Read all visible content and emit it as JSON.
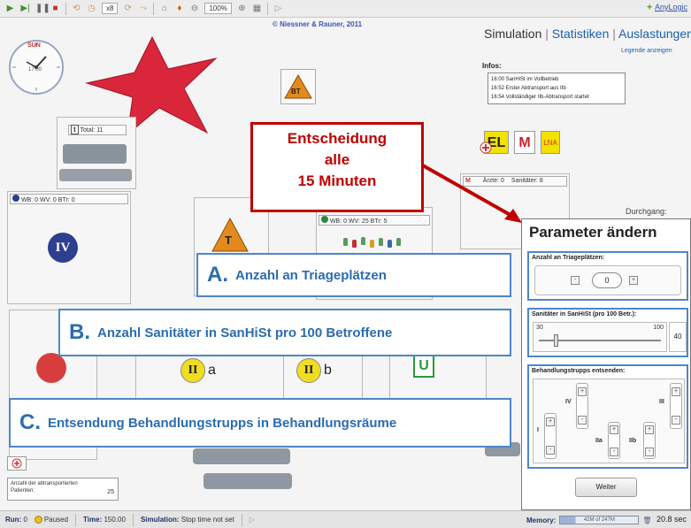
{
  "toolbar": {
    "speed": "x8",
    "zoom": "100%",
    "brand": "AnyLogic"
  },
  "header": {
    "copyright": "© Niessner & Rauner, 2011",
    "tabs": [
      "Simulation",
      "Statistiken",
      "Auslastungen"
    ],
    "separator": "|",
    "legend_link": "Legende anzeigen"
  },
  "infos": {
    "title": "Infos:",
    "lines": [
      "16:00 SanHiSt im Vollbetrieb",
      "16:52 Erster Abtransport aus IIb",
      "16:54 Vollständiger IIb-Abtransport startet"
    ]
  },
  "clock": {
    "label": "SUN",
    "time": "17:00"
  },
  "markers": {
    "bt": "BT",
    "t": "T",
    "el": "EL",
    "m": "M",
    "lna": "LNA",
    "u": "U",
    "iv": "IV",
    "iia": "II",
    "iia_suffix": "a",
    "iib": "II",
    "iib_suffix": "b",
    "room_m": "M"
  },
  "triage_box": {
    "icon": "t",
    "label": "Total:",
    "value": "11"
  },
  "bar_iv": {
    "wb_label": "WB:",
    "wb": "0",
    "wv_label": "WV:",
    "wv": "0",
    "btr_label": "BTr:",
    "btr": "0"
  },
  "bar_center": {
    "wb_label": "WB:",
    "wb": "0",
    "wv_label": "WV:",
    "wv": "25",
    "btr_label": "BTr:",
    "btr": "5"
  },
  "staff_bar": {
    "aerzte_label": "Ärzte:",
    "aerzte": "0",
    "sani_label": "Sanitäter:",
    "sani": "8"
  },
  "durchgang_label": "Durchgang:",
  "transported": {
    "label": "Anzahl der abtransportierten Patienten:",
    "value": "25"
  },
  "decision": {
    "line1": "Entscheidung",
    "line2": "alle",
    "line3": "15 Minuten"
  },
  "callouts": {
    "a": {
      "letter": "A.",
      "text": "Anzahl an Triageplätzen"
    },
    "b": {
      "letter": "B.",
      "text": "Anzahl Sanitäter in SanHiSt pro 100 Betroffene"
    },
    "c": {
      "letter": "C.",
      "text": "Entsendung Behandlungstrupps in Behandlungsräume"
    }
  },
  "params": {
    "title": "Parameter ändern",
    "triage": {
      "label": "Anzahl an Triageplätzen:",
      "value": "0",
      "minus": "-",
      "plus": "+"
    },
    "sani": {
      "label": "Sanitäter in SanHiSt (pro 100 Betr.):",
      "min": "30",
      "max": "100",
      "value": "40",
      "slider_fraction": 0.14
    },
    "trupps": {
      "label": "Behandlungstrupps entsenden:",
      "plus": "+",
      "minus": "-",
      "groups": [
        "I",
        "IV",
        "IIa",
        "IIb",
        "III"
      ]
    },
    "weiter": "Weiter"
  },
  "status": {
    "run_label": "Run:",
    "run": "0",
    "state": "Paused",
    "time_label": "Time:",
    "time": "150.00",
    "sim_label": "Simulation:",
    "sim": "Stop time not set",
    "memory_label": "Memory:",
    "memory": "42M of 247M",
    "speed": "20.8 sec"
  },
  "colors": {
    "callout_border": "#4f86c6",
    "callout_text": "#2b6cb0",
    "decision_red": "#c00000",
    "star_red": "#d9263a",
    "tab_blue": "#1a5fb4"
  }
}
